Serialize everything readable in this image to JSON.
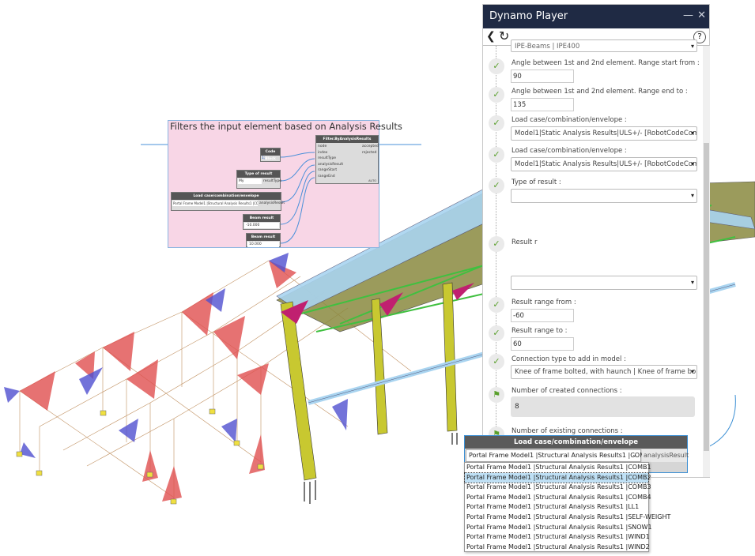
{
  "group": {
    "title": "Filters the input element based on Analysis Results",
    "filter_node": {
      "title": "Filter.ByAnalysisResults",
      "inputs": [
        "node",
        "index",
        "resultType",
        "analysisResult",
        "rangeStart",
        "rangeEnd"
      ],
      "outputs": [
        "accepted",
        "rejected"
      ],
      "footer": "AUTO"
    },
    "code_block": {
      "title": "Code Block",
      "value": "1;"
    },
    "type_result": {
      "title": "Type of result",
      "value": "My",
      "port": "resultType"
    },
    "load_case": {
      "title": "Load case/combination/envelope",
      "value": "Portal Frame Model1 |Structural Analysis Results1 |COMB1",
      "port": "analysisResult"
    },
    "range_from": {
      "title": "Beam result range from",
      "value": "-10.000"
    },
    "range_to": {
      "title": "Beam result range to",
      "value": "10.000"
    }
  },
  "player": {
    "title": "Dynamo Player",
    "minimize": "—",
    "close": "✕",
    "back": "❮",
    "refresh": "↻",
    "help": "?",
    "top_select": "IPE-Beams | IPE400",
    "fields": [
      {
        "label": "Angle between 1st and 2nd element. Range start from :",
        "value": "90"
      },
      {
        "label": "Angle between 1st and 2nd element. Range end to :",
        "value": "135"
      },
      {
        "label": "Load case/combination/envelope :",
        "value": "Model1|Static Analysis Results|ULS+/- [RobotCodeCombination"
      },
      {
        "label": "Load case/combination/envelope :",
        "value": "Model1|Static Analysis Results|ULS+/- [RobotCodeCombination"
      },
      {
        "label": "Type of result :",
        "value": ""
      },
      {
        "label": "Result r",
        "value": ""
      },
      {
        "label": "Result range from :",
        "value": "-60"
      },
      {
        "label": "Result range to :",
        "value": "60"
      },
      {
        "label": "Connection type to add in model :",
        "value": "Knee of frame bolted, with haunch | Knee of frame bolted, with"
      },
      {
        "label": "Number of created connections :",
        "value": "8"
      },
      {
        "label": "Number of existing connections :",
        "value": ""
      }
    ]
  },
  "dropdown": {
    "title": "Load case/combination/envelope",
    "selected": "Portal Frame Model1 |Structural Analysis Results1 |COMB1",
    "port": "analysisResult",
    "highlighted_index": 1,
    "options": [
      "Portal Frame Model1 |Structural Analysis Results1 |COMB1",
      "Portal Frame Model1 |Structural Analysis Results1 |COMB2",
      "Portal Frame Model1 |Structural Analysis Results1 |COMB3",
      "Portal Frame Model1 |Structural Analysis Results1 |COMB4",
      "Portal Frame Model1 |Structural Analysis Results1 |LL1",
      "Portal Frame Model1 |Structural Analysis Results1 |SELF-WEIGHT",
      "Portal Frame Model1 |Structural Analysis Results1 |SNOW1",
      "Portal Frame Model1 |Structural Analysis Results1 |WIND1",
      "Portal Frame Model1 |Structural Analysis Results1 |WIND2"
    ]
  }
}
